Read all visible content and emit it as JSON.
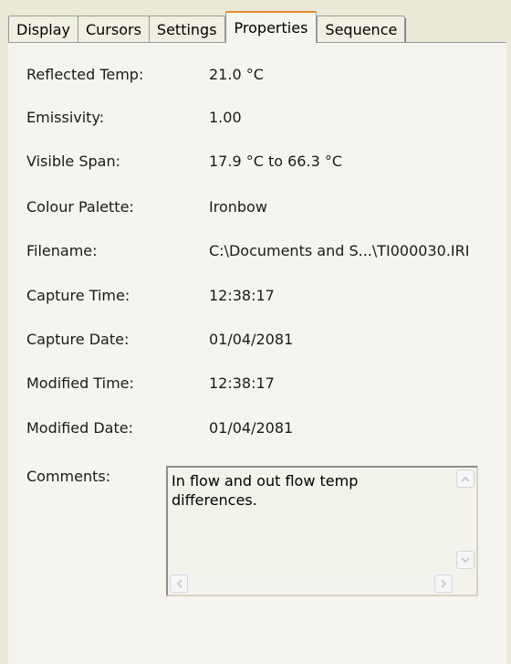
{
  "tabs": [
    {
      "label": "Display",
      "active": false
    },
    {
      "label": "Cursors",
      "active": false
    },
    {
      "label": "Settings",
      "active": false
    },
    {
      "label": "Properties",
      "active": true
    },
    {
      "label": "Sequence",
      "active": false
    }
  ],
  "properties": [
    {
      "label": "Reflected Temp:",
      "value": "21.0 °C"
    },
    {
      "label": "Emissivity:",
      "value": "1.00"
    },
    {
      "label": "Visible Span:",
      "value": "17.9 °C to 66.3 °C"
    },
    {
      "label": "Colour Palette:",
      "value": "Ironbow"
    },
    {
      "label": "Filename:",
      "value": "C:\\Documents and S...\\TI000030.IRI"
    },
    {
      "label": "Capture Time:",
      "value": "12:38:17"
    },
    {
      "label": "Capture Date:",
      "value": "01/04/2081"
    },
    {
      "label": "Modified Time:",
      "value": "12:38:17"
    },
    {
      "label": "Modified Date:",
      "value": "01/04/2081"
    }
  ],
  "comments": {
    "label": "Comments:",
    "text": "In flow and out flow temp differences."
  },
  "icons": {
    "scroll_up": "chevron-up-icon",
    "scroll_down": "chevron-down-icon",
    "scroll_left": "chevron-left-icon",
    "scroll_right": "chevron-right-icon"
  },
  "colors": {
    "window_bg": "#ece9d8",
    "panel_bg": "#f5f4ee",
    "active_tab_accent": "#e68b2c"
  }
}
